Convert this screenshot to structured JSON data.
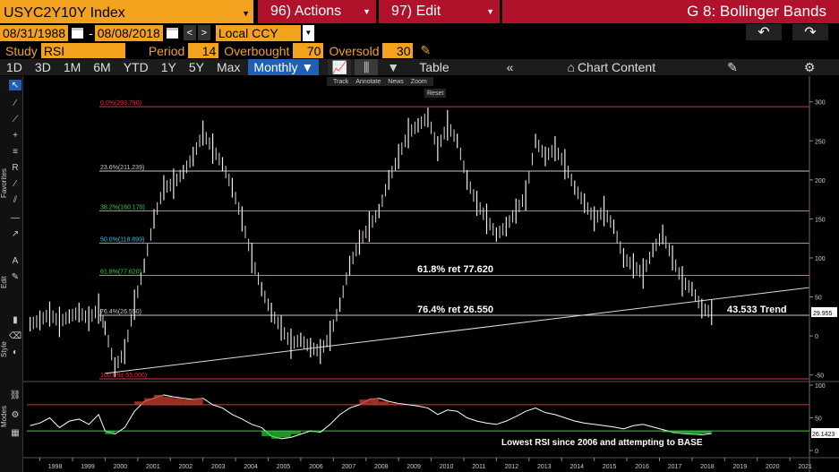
{
  "header": {
    "ticker": "USYC2Y10Y Index",
    "actions_label": "96) Actions",
    "edit_label": "97) Edit",
    "chart_title": "G 8: Bollinger Bands"
  },
  "dates": {
    "start": "08/31/1988",
    "separator": "-",
    "end": "08/08/2018",
    "currency": "Local CCY"
  },
  "study": {
    "study_label": "Study",
    "study_value": "RSI",
    "period_label": "Period",
    "period_value": "14",
    "overbought_label": "Overbought",
    "overbought_value": "70",
    "oversold_label": "Oversold",
    "oversold_value": "30"
  },
  "toolbar": {
    "ranges": [
      "1D",
      "3D",
      "1M",
      "6M",
      "YTD",
      "1Y",
      "5Y",
      "Max"
    ],
    "frequency": "Monthly ▼",
    "table_label": "Table",
    "chart_content_label": "Chart Content"
  },
  "float_toolbar": {
    "track": "Track",
    "annotate": "Annotate",
    "news": "News",
    "zoom": "Zoom",
    "reset": "Reset"
  },
  "sidebar_tabs": {
    "favorites": "Favorites",
    "edit": "Edit",
    "style": "Style",
    "modes": "Modes"
  },
  "colors": {
    "accent": "#f3a21e",
    "brand": "#b0112b",
    "selected": "#1f5fb4"
  },
  "chart_data": {
    "type": "line",
    "main_y_ticks": [
      300,
      250,
      200,
      150,
      100,
      50,
      0,
      -50
    ],
    "ylim": [
      -55,
      310
    ],
    "x_start_year": 1997.6,
    "x_end_year": 2021.6,
    "x_ticks": [
      "1998",
      "1999",
      "2000",
      "2001",
      "2002",
      "2003",
      "2004",
      "2005",
      "2006",
      "2007",
      "2008",
      "2009",
      "2010",
      "2011",
      "2012",
      "2013",
      "2014",
      "2015",
      "2016",
      "2017",
      "2018",
      "2019",
      "2020",
      "2021"
    ],
    "fib_levels": [
      {
        "label": "0.0%(293.790)",
        "value": 293.79,
        "color": "#e0323c"
      },
      {
        "label": "23.6%(211.239)",
        "value": 211.239,
        "color": "#c8c8c8"
      },
      {
        "label": "38.2%(160.170)",
        "value": 160.17,
        "color": "#2bd43a"
      },
      {
        "label": "50.0%(118.899)",
        "value": 118.899,
        "color": "#33c4d4"
      },
      {
        "label": "61.8%(77.620)",
        "value": 77.62,
        "color": "#2bd43a"
      },
      {
        "label": "76.4%(26.550)",
        "value": 26.55,
        "color": "#c8c8c8"
      },
      {
        "label": "100.0%(-55.000)",
        "value": -55,
        "color": "#e0323c"
      }
    ],
    "trendline": {
      "from": {
        "x": 2000.0,
        "y": -48
      },
      "to": {
        "x": 2021.6,
        "y": 62
      }
    },
    "series": [
      {
        "x": [
          1997.7,
          1998.0,
          1998.3,
          1998.6,
          1998.9,
          1999.2,
          1999.5,
          1999.8,
          2000.0,
          2000.3,
          2000.6,
          2000.9,
          2001.2,
          2001.5,
          2001.8,
          2002.1,
          2002.4,
          2002.7,
          2003.0,
          2003.3,
          2003.6,
          2003.9,
          2004.2,
          2004.5,
          2004.8,
          2005.1,
          2005.4,
          2005.7,
          2006.0,
          2006.3,
          2006.6,
          2006.9,
          2007.2,
          2007.5,
          2007.8,
          2008.1,
          2008.4,
          2008.7,
          2009.0,
          2009.3,
          2009.6,
          2009.9,
          2010.2,
          2010.5,
          2010.8,
          2011.1,
          2011.4,
          2011.7,
          2012.0,
          2012.3,
          2012.6,
          2012.9,
          2013.2,
          2013.5,
          2013.8,
          2014.1,
          2014.4,
          2014.7,
          2015.0,
          2015.3,
          2015.6,
          2015.9,
          2016.2,
          2016.5,
          2016.8,
          2017.1,
          2017.4,
          2017.7,
          2018.0,
          2018.3,
          2018.6
        ],
        "values": [
          15,
          20,
          28,
          18,
          25,
          30,
          22,
          35,
          10,
          -40,
          -20,
          40,
          90,
          150,
          190,
          195,
          210,
          230,
          260,
          240,
          220,
          190,
          150,
          100,
          60,
          30,
          10,
          -10,
          -5,
          -15,
          -20,
          0,
          40,
          90,
          120,
          140,
          160,
          200,
          230,
          260,
          270,
          280,
          240,
          270,
          250,
          200,
          170,
          150,
          130,
          140,
          160,
          180,
          250,
          230,
          240,
          220,
          190,
          170,
          150,
          160,
          140,
          100,
          90,
          80,
          110,
          130,
          100,
          70,
          60,
          35,
          30
        ]
      }
    ],
    "annotations": [
      "61.8% ret 77.620",
      "76.4% ret 26.550",
      "43.533 Trend"
    ],
    "last_value": "29.955",
    "rsi": {
      "y_ticks": [
        100,
        50,
        0
      ],
      "overbought": 70,
      "oversold": 30,
      "values": [
        38,
        42,
        50,
        35,
        45,
        48,
        40,
        55,
        30,
        25,
        35,
        60,
        75,
        80,
        85,
        82,
        80,
        78,
        80,
        70,
        65,
        55,
        48,
        40,
        35,
        22,
        18,
        20,
        25,
        30,
        28,
        40,
        55,
        65,
        70,
        78,
        80,
        75,
        72,
        70,
        68,
        65,
        55,
        62,
        60,
        50,
        45,
        42,
        40,
        45,
        52,
        60,
        65,
        58,
        55,
        50,
        45,
        42,
        40,
        38,
        36,
        33,
        38,
        40,
        36,
        32,
        28,
        26,
        25,
        24,
        26
      ],
      "last_value": "26.1423",
      "annotation": "Lowest RSI since 2006 and attempting to BASE"
    }
  }
}
